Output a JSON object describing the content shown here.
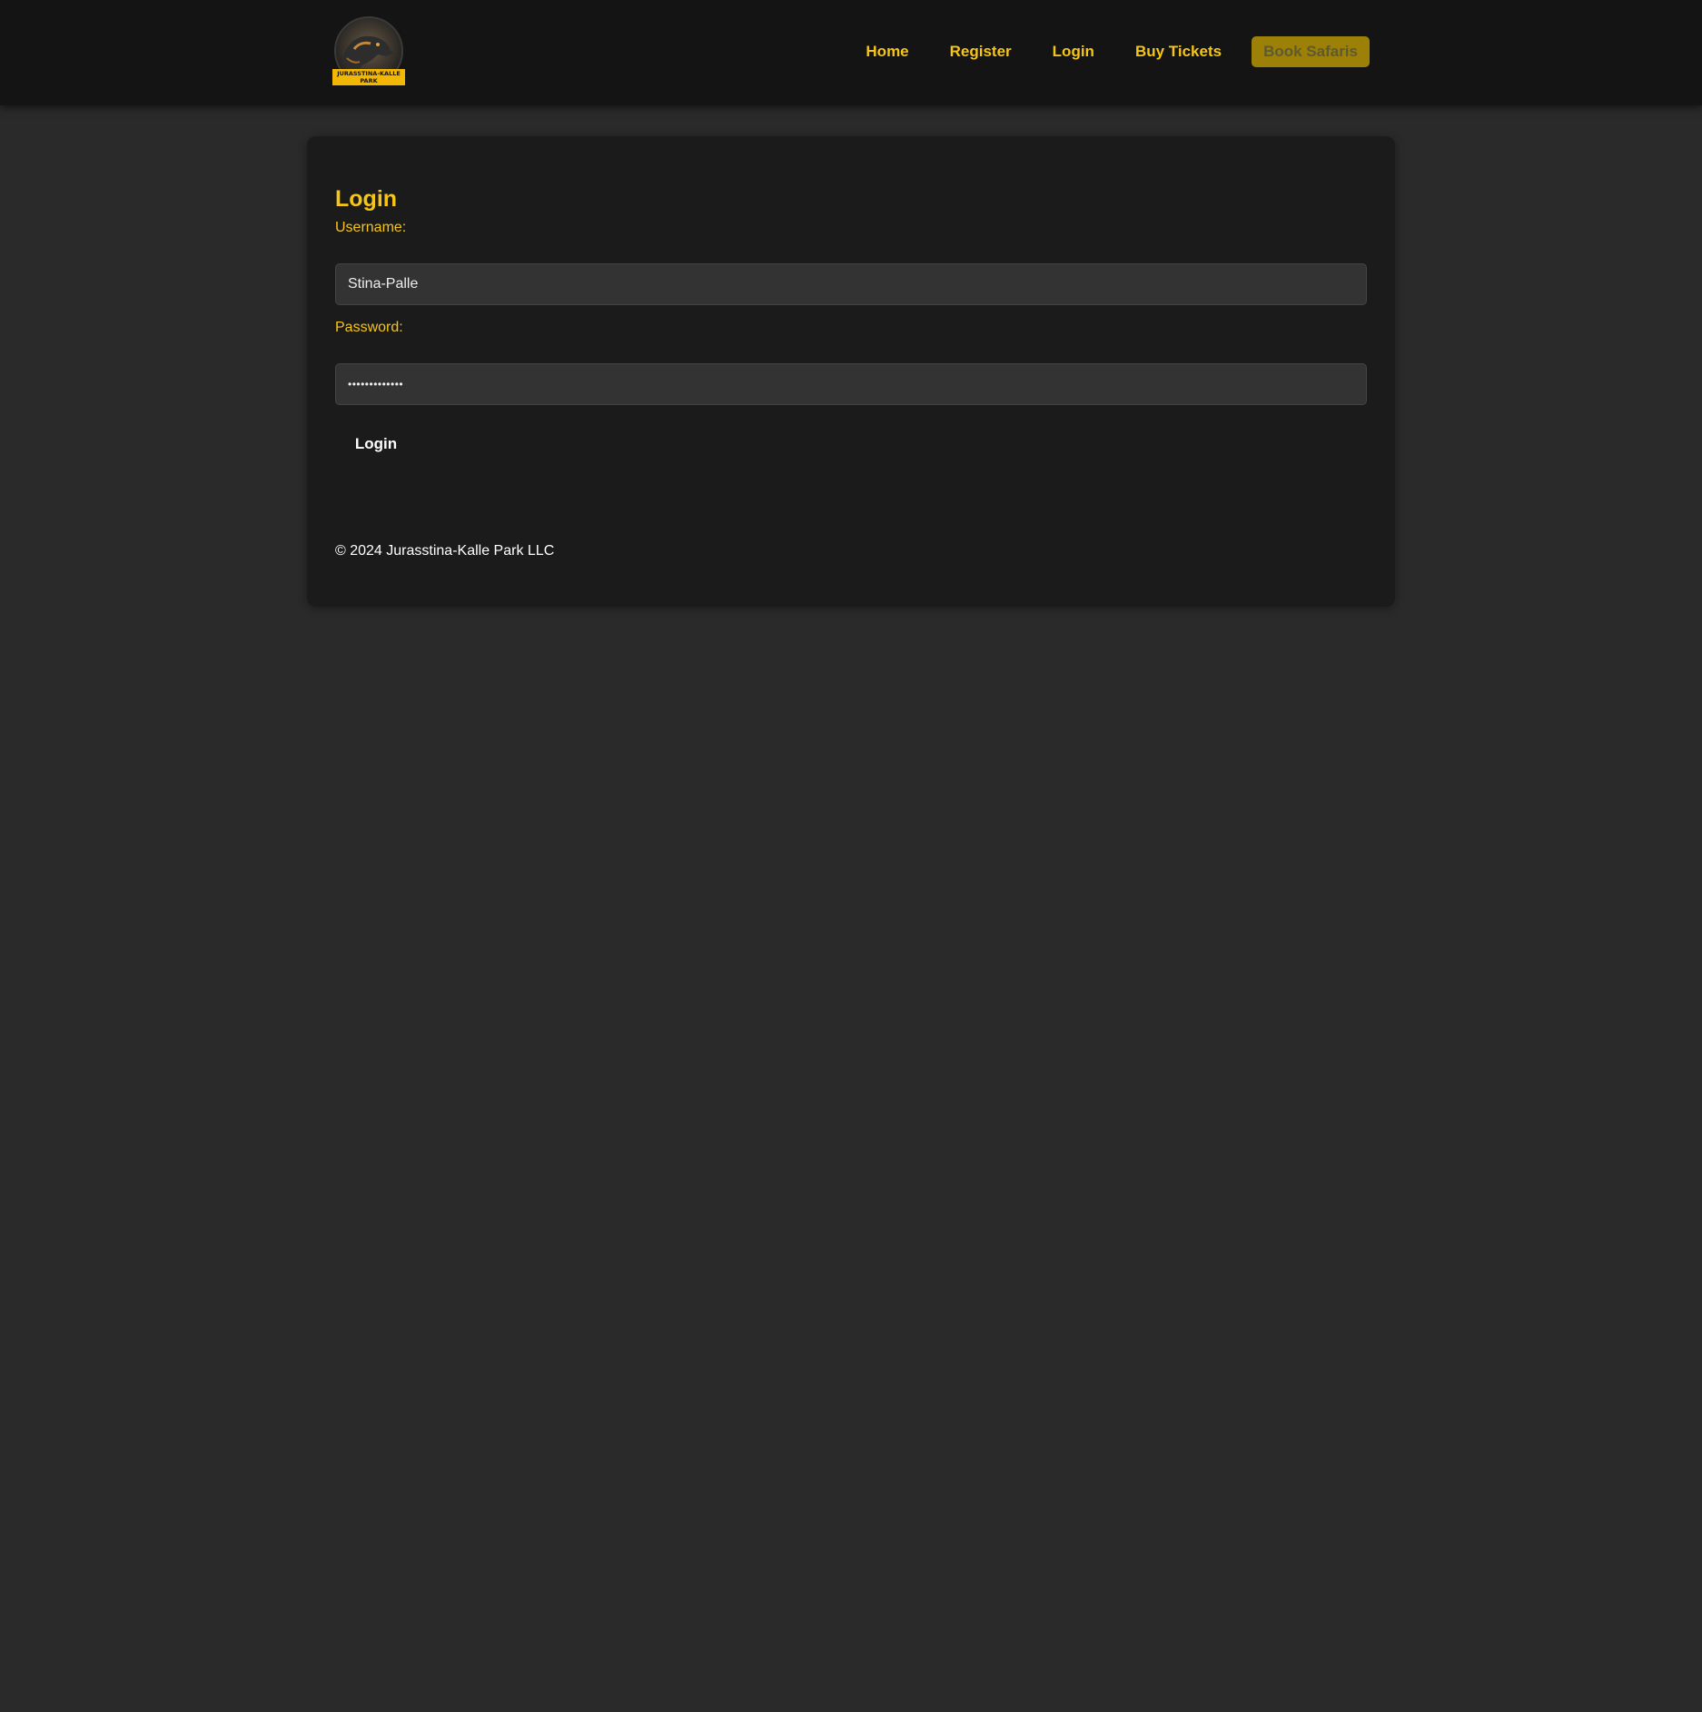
{
  "header": {
    "logo_text": "JURASSTINA-KALLE PARK",
    "nav": [
      {
        "label": "Home"
      },
      {
        "label": "Register"
      },
      {
        "label": "Login"
      },
      {
        "label": "Buy Tickets"
      }
    ],
    "cta_label": "Book Safaris"
  },
  "login_form": {
    "title": "Login",
    "username_label": "Username:",
    "username_value": "Stina-Palle",
    "password_label": "Password:",
    "password_value": "•••••••••••••",
    "submit_label": "Login"
  },
  "footer": {
    "copyright": "© 2024 Jurasstina-Kalle Park LLC"
  },
  "colors": {
    "accent": "#f5c518",
    "page_bg": "#2a2a2a",
    "header_bg": "#141414",
    "card_bg": "#1b1b1b",
    "input_bg": "#333333",
    "cta_bg": "#9c8008"
  },
  "icons": {
    "logo": "dinosaur-emblem"
  }
}
